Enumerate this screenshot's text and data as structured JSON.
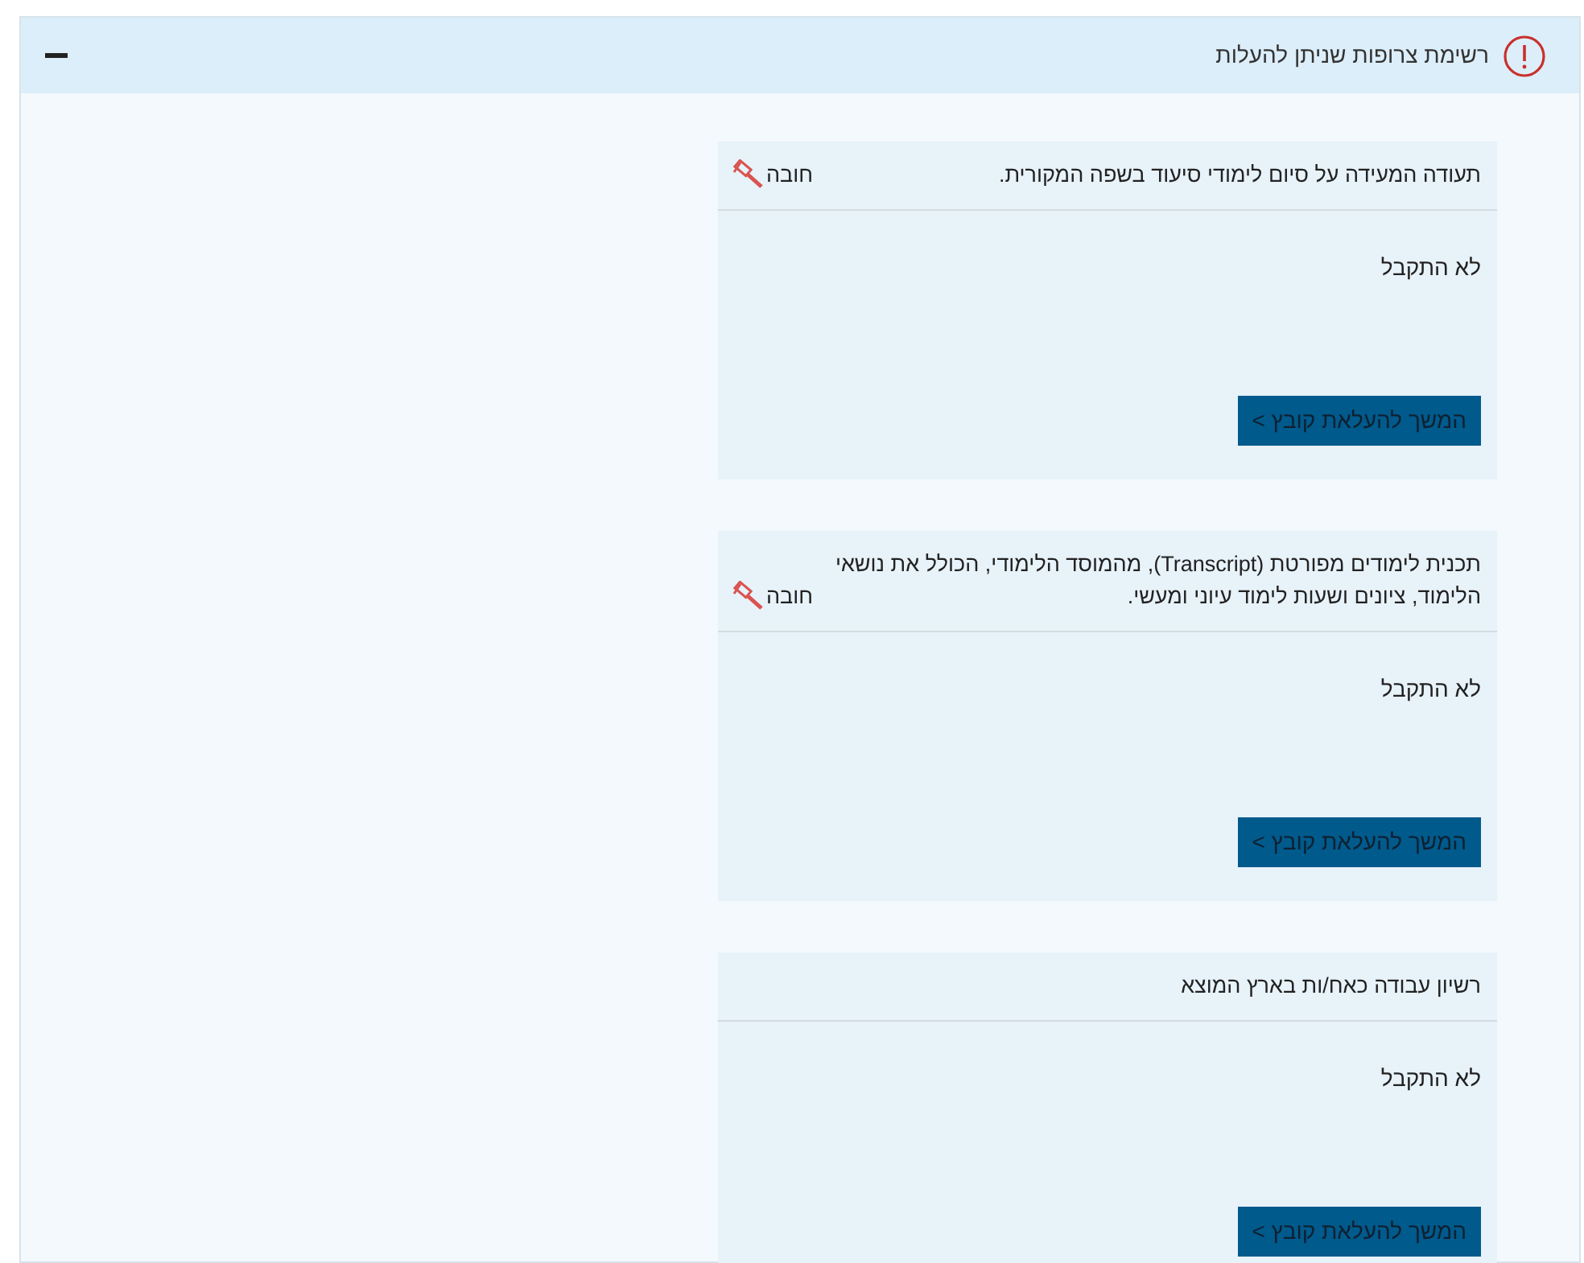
{
  "panel": {
    "title": "רשימת צרופות שניתן להעלות",
    "expanded": true
  },
  "attachments": [
    {
      "title": "תעודה המעידה על סיום לימודי סיעוד בשפה המקורית.",
      "required": true,
      "required_label": "חובה",
      "status": "לא התקבל",
      "button": "המשך להעלאת קובץ >"
    },
    {
      "title": "תכנית לימודים מפורטת (Transcript), מהמוסד הלימודי, הכולל את נושאי הלימוד, ציונים ושעות לימוד עיוני ומעשי.",
      "required": true,
      "required_label": "חובה",
      "status": "לא התקבל",
      "button": "המשך להעלאת קובץ >"
    },
    {
      "title": "רשיון עבודה כאח/ות בארץ המוצא",
      "required": false,
      "status": "לא התקבל",
      "button": "המשך להעלאת קובץ >"
    }
  ]
}
